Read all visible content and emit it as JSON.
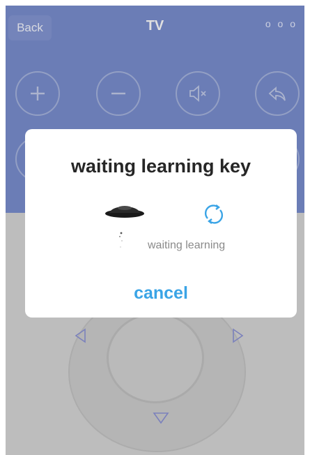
{
  "header": {
    "back_label": "Back",
    "title": "TV",
    "more_label": "o o o"
  },
  "remote": {
    "buttons": [
      {
        "name": "volume-up",
        "icon": "plus-icon"
      },
      {
        "name": "volume-down",
        "icon": "minus-icon"
      },
      {
        "name": "mute",
        "icon": "mute-icon"
      },
      {
        "name": "return",
        "icon": "return-icon"
      }
    ],
    "dpad_arrows": [
      "left-arrow-icon",
      "right-arrow-icon",
      "down-arrow-icon"
    ]
  },
  "dialog": {
    "title": "waiting learning key",
    "status": "waiting learning",
    "cancel_label": "cancel"
  },
  "colors": {
    "header_bg": "#7a8fd0",
    "accent": "#3aa4e6",
    "body_bg": "#d8d8d8"
  }
}
